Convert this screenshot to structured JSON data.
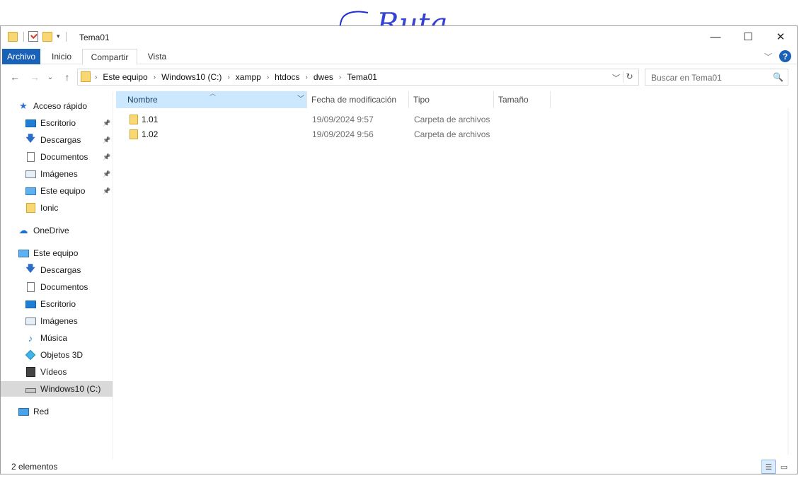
{
  "annotation": {
    "handwritten_text": "Ruta"
  },
  "window": {
    "title": "Tema01",
    "controls": {
      "minimize": "—",
      "maximize": "☐",
      "close": "✕"
    }
  },
  "ribbon": {
    "tabs": [
      "Archivo",
      "Inicio",
      "Compartir",
      "Vista"
    ],
    "help_label": "?"
  },
  "address": {
    "back": "←",
    "forward": "→",
    "recent": "⌄",
    "up": "↑",
    "crumbs": [
      "Este equipo",
      "Windows10 (C:)",
      "xampp",
      "htdocs",
      "dwes",
      "Tema01"
    ],
    "separator": "›",
    "refresh": "↻"
  },
  "search": {
    "placeholder": "Buscar en Tema01",
    "icon": "🔍"
  },
  "sidebar": {
    "quick_access": {
      "label": "Acceso rápido",
      "icon": "star-icon"
    },
    "quick_items": [
      {
        "label": "Escritorio",
        "icon": "desktop-icon"
      },
      {
        "label": "Descargas",
        "icon": "download-icon"
      },
      {
        "label": "Documentos",
        "icon": "document-icon"
      },
      {
        "label": "Imágenes",
        "icon": "pictures-icon"
      },
      {
        "label": "Este equipo",
        "icon": "computer-icon"
      },
      {
        "label": "Ionic",
        "icon": "folder-icon"
      }
    ],
    "onedrive": {
      "label": "OneDrive",
      "icon": "cloud-icon"
    },
    "this_pc": {
      "label": "Este equipo",
      "icon": "computer-icon"
    },
    "pc_items": [
      {
        "label": "Descargas",
        "icon": "download-icon"
      },
      {
        "label": "Documentos",
        "icon": "document-icon"
      },
      {
        "label": "Escritorio",
        "icon": "desktop-icon"
      },
      {
        "label": "Imágenes",
        "icon": "pictures-icon"
      },
      {
        "label": "Música",
        "icon": "music-icon"
      },
      {
        "label": "Objetos 3D",
        "icon": "cube-icon"
      },
      {
        "label": "Vídeos",
        "icon": "video-icon"
      },
      {
        "label": "Windows10 (C:)",
        "icon": "drive-icon",
        "selected": true
      }
    ],
    "network": {
      "label": "Red",
      "icon": "network-icon"
    },
    "pin_glyph": "📌"
  },
  "columns": {
    "name": "Nombre",
    "date": "Fecha de modificación",
    "type": "Tipo",
    "size": "Tamaño"
  },
  "files": [
    {
      "name": "1.01",
      "date": "19/09/2024 9:57",
      "type": "Carpeta de archivos"
    },
    {
      "name": "1.02",
      "date": "19/09/2024 9:56",
      "type": "Carpeta de archivos"
    }
  ],
  "status": {
    "count": "2 elementos"
  },
  "colors": {
    "accent": "#1a61b8",
    "highlight": "#f5f500",
    "ink": "#1f2fd0",
    "selected_column": "#cce8ff"
  }
}
